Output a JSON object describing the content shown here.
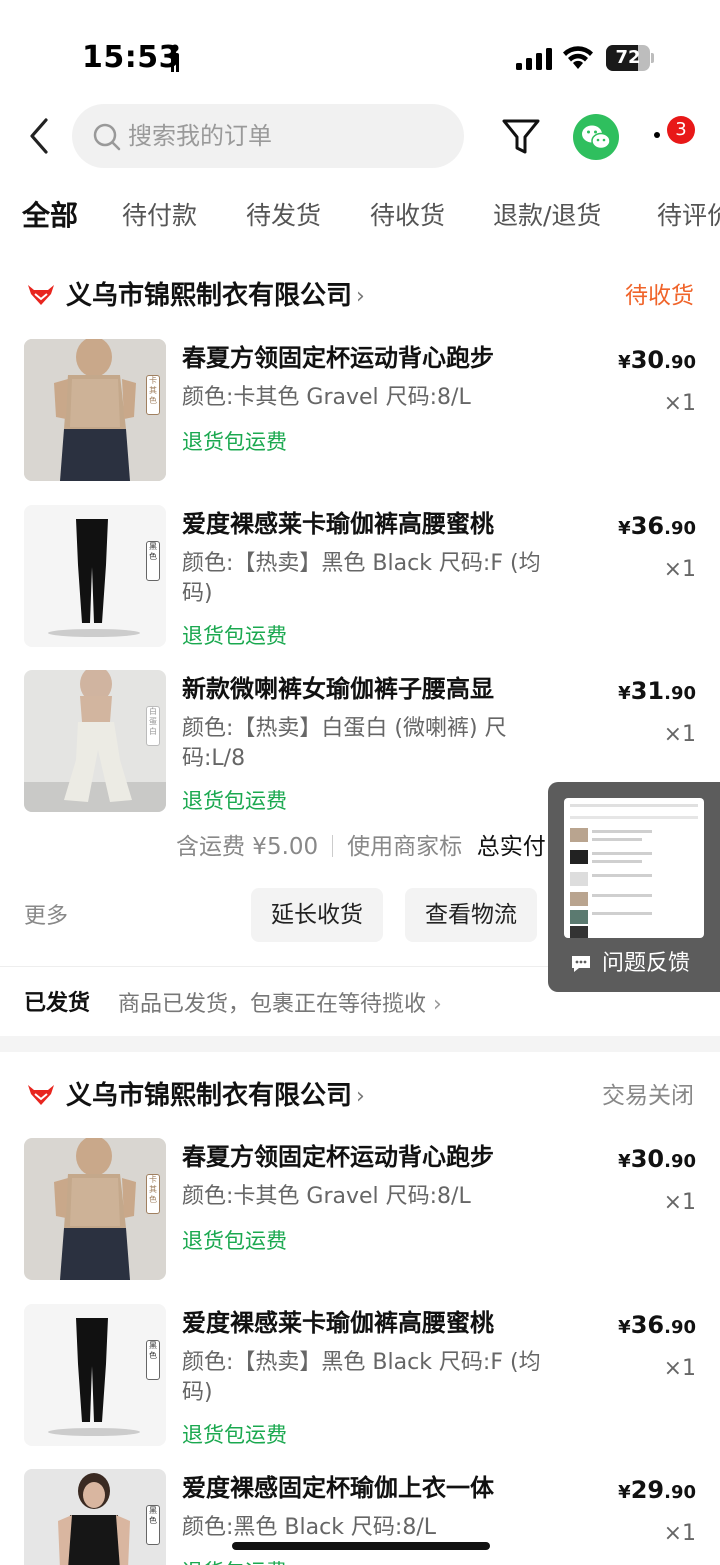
{
  "status_bar": {
    "time": "15:53",
    "battery": "72",
    "battery_level": 0.72
  },
  "search": {
    "placeholder": "搜索我的订单"
  },
  "notifications": {
    "badge_count": "3"
  },
  "tabs": [
    {
      "label": "全部",
      "active": true
    },
    {
      "label": "待付款"
    },
    {
      "label": "待发货"
    },
    {
      "label": "待收货"
    },
    {
      "label": "退款/退货"
    },
    {
      "label": "待评价"
    }
  ],
  "orders": [
    {
      "shop_name": "义乌市锦熙制衣有限公司",
      "status": "待收货",
      "status_color": "#f0642a",
      "items": [
        {
          "title": "春夏方领固定杯运动背心跑步",
          "spec": "颜色:卡其色 Gravel 尺码:8/L",
          "refund_tag": "退货包运费",
          "price_int": "30",
          "price_dec": ".90",
          "qty": "×1",
          "thumb_tag": "卡其色"
        },
        {
          "title": "爱度裸感莱卡瑜伽裤高腰蜜桃",
          "spec": "颜色:【热卖】黑色 Black 尺码:F (均码)",
          "refund_tag": "退货包运费",
          "price_int": "36",
          "price_dec": ".90",
          "qty": "×1",
          "thumb_tag": "黑色"
        },
        {
          "title": "新款微喇裤女瑜伽裤子腰高显",
          "spec": "颜色:【热卖】白蛋白 (微喇裤) 尺码:L/8",
          "refund_tag": "退货包运费",
          "price_int": "31",
          "price_dec": ".90",
          "qty": "×1",
          "thumb_tag": "白蛋白"
        }
      ],
      "shipping_fee": "含运费 ¥5.00",
      "merchant_note": "使用商家标",
      "total_label": "总实付",
      "more": "更多",
      "buttons": [
        "延长收货",
        "查看物流"
      ],
      "ship_label": "已发货",
      "ship_text": "商品已发货，包裹正在等待揽收"
    },
    {
      "shop_name": "义乌市锦熙制衣有限公司",
      "status": "交易关闭",
      "status_color": "#888888",
      "items": [
        {
          "title": "春夏方领固定杯运动背心跑步",
          "spec": "颜色:卡其色 Gravel 尺码:8/L",
          "refund_tag": "退货包运费",
          "price_int": "30",
          "price_dec": ".90",
          "qty": "×1",
          "thumb_tag": "卡其色"
        },
        {
          "title": "爱度裸感莱卡瑜伽裤高腰蜜桃",
          "spec": "颜色:【热卖】黑色 Black 尺码:F (均码)",
          "refund_tag": "退货包运费",
          "price_int": "36",
          "price_dec": ".90",
          "qty": "×1",
          "thumb_tag": "黑色"
        },
        {
          "title": "爱度裸感固定杯瑜伽上衣一体",
          "spec": "颜色:黑色 Black 尺码:8/L",
          "refund_tag": "退货包运费",
          "price_int": "29",
          "price_dec": ".90",
          "qty": "×1",
          "thumb_tag": "黑色"
        }
      ]
    }
  ],
  "feedback": {
    "label": "问题反馈"
  }
}
